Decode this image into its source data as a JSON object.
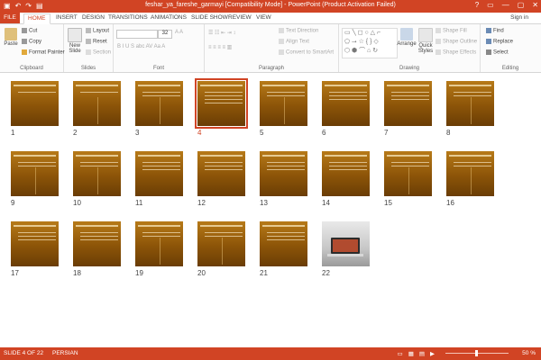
{
  "window": {
    "title": "feshar_ya_fareshe_garmayi [Compatibility Mode] - PowerPoint (Product Activation Failed)",
    "controls": [
      "?",
      "▭",
      "—",
      "▢",
      "✕"
    ]
  },
  "qat": [
    "save-icon",
    "undo-icon",
    "redo-icon",
    "present-icon"
  ],
  "tabs": [
    "FILE",
    "HOME",
    "INSERT",
    "DESIGN",
    "TRANSITIONS",
    "ANIMATIONS",
    "SLIDE SHOW",
    "REVIEW",
    "VIEW"
  ],
  "active_tab": "HOME",
  "signin": "Sign in",
  "ribbon": {
    "clipboard": {
      "label": "Clipboard",
      "paste": "Paste",
      "cut": "Cut",
      "copy": "Copy",
      "format_painter": "Format Painter"
    },
    "slides": {
      "label": "Slides",
      "new_slide": "New Slide",
      "layout": "Layout",
      "reset": "Reset",
      "section": "Section"
    },
    "font": {
      "label": "Font",
      "size": "32"
    },
    "paragraph": {
      "label": "Paragraph",
      "text_direction": "Text Direction",
      "align_text": "Align Text",
      "smartart": "Convert to SmartArt"
    },
    "drawing": {
      "label": "Drawing",
      "arrange": "Arrange",
      "quick_styles": "Quick Styles",
      "shape_fill": "Shape Fill",
      "shape_outline": "Shape Outline",
      "shape_effects": "Shape Effects"
    },
    "editing": {
      "label": "Editing",
      "find": "Find",
      "replace": "Replace",
      "select": "Select"
    }
  },
  "slides": [
    "1",
    "2",
    "3",
    "4",
    "5",
    "6",
    "7",
    "8",
    "9",
    "10",
    "11",
    "12",
    "13",
    "14",
    "15",
    "16",
    "17",
    "18",
    "19",
    "20",
    "21",
    "22"
  ],
  "selected_slide": "4",
  "status": {
    "slide_info": "SLIDE 4 OF 22",
    "language": "PERSIAN",
    "zoom": "50 %"
  }
}
